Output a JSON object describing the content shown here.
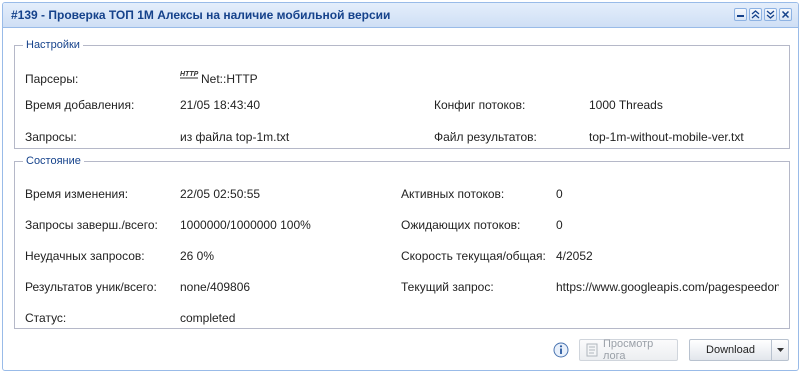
{
  "window": {
    "title": "#139 - Проверка ТОП 1М Алексы на наличие мобильной версии",
    "tools": [
      "minimize-icon",
      "double-chevron-up-icon",
      "double-chevron-down-icon",
      "close-icon"
    ]
  },
  "settings": {
    "legend": "Настройки",
    "parsers_label": "Парсеры:",
    "parsers_icon": "http-icon",
    "parsers_value": "Net::HTTP",
    "added_label": "Время добавления:",
    "added_value": "21/05 18:43:40",
    "threads_config_label": "Конфиг потоков:",
    "threads_config_value": "1000 Threads",
    "queries_label": "Запросы:",
    "queries_value": "из файла top-1m.txt",
    "results_file_label": "Файл результатов:",
    "results_file_value": "top-1m-without-mobile-ver.txt"
  },
  "state": {
    "legend": "Состояние",
    "changed_label": "Время изменения:",
    "changed_value": "22/05 02:50:55",
    "active_threads_label": "Активных потоков:",
    "active_threads_value": "0",
    "queries_done_label": "Запросы заверш./всего:",
    "queries_done_value": "1000000/1000000 100%",
    "waiting_threads_label": "Ожидающих потоков:",
    "waiting_threads_value": "0",
    "failed_label": "Неудачных запросов:",
    "failed_value": "26 0%",
    "speed_label": "Скорость текущая/общая:",
    "speed_value": "4/2052",
    "results_label": "Результатов уник/всего:",
    "results_value": "none/409806",
    "current_query_label": "Текущий запрос:",
    "current_query_value": "https://www.googleapis.com/pagespeedonline",
    "status_label": "Статус:",
    "status_value": "completed"
  },
  "footer": {
    "info_icon": "info-icon",
    "view_log_label": "Просмотр лога",
    "download_label": "Download"
  },
  "colors": {
    "title": "#15428b",
    "border": "#99bbe8",
    "legend": "#15428b"
  }
}
